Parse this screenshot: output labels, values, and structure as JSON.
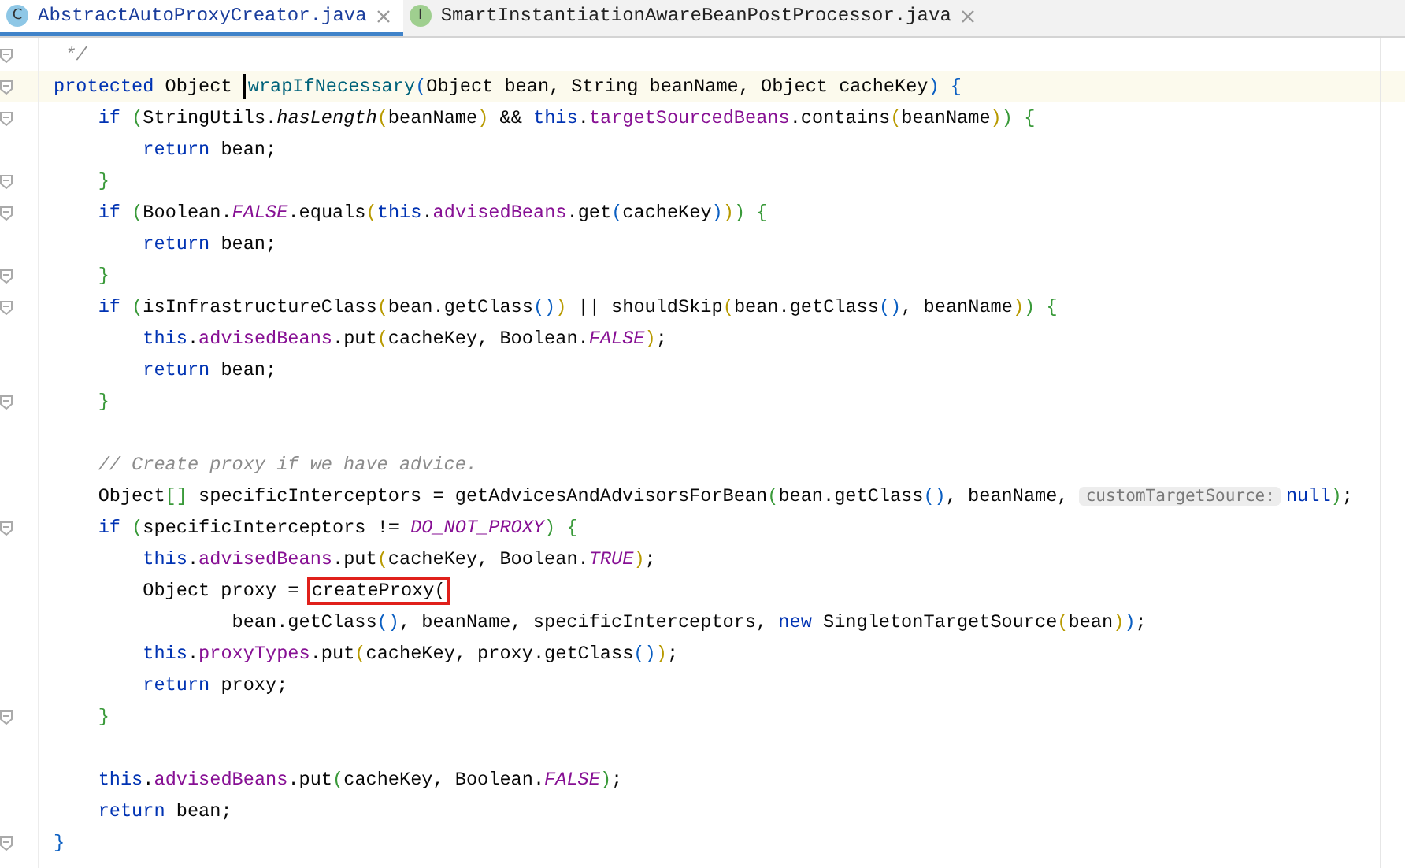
{
  "tabs": [
    {
      "badge": "C",
      "label": "AbstractAutoProxyCreator.java",
      "selected": true
    },
    {
      "badge": "I",
      "label": "SmartInstantiationAwareBeanPostProcessor.java",
      "selected": false
    }
  ],
  "code": [
    {
      "fold": true,
      "tokens": [
        {
          "kind": "comment",
          "text": "*/",
          "spaced": true
        }
      ]
    },
    {
      "fold": true,
      "current": true,
      "tokens": [
        {
          "kind": "keyword",
          "text": "protected"
        },
        {
          "kind": "plain",
          "text": " Object "
        },
        {
          "kind": "decl",
          "text": "wrapIfNecessary",
          "caret": true
        },
        {
          "kind": "bracket",
          "color": "#0b5fc2",
          "text": "("
        },
        {
          "kind": "plain",
          "text": "Object bean, String beanName, Object cacheKey"
        },
        {
          "kind": "bracket",
          "color": "#0b5fc2",
          "text": ")"
        },
        {
          "kind": "bracket",
          "color": "#0b5fc2",
          "text": "{",
          "spaced": true
        }
      ],
      "children": [
        {
          "fold": true,
          "tokens": [
            {
              "kind": "keyword",
              "text": "if"
            },
            {
              "kind": "bracket",
              "color": "#3a9a3a",
              "text": "(",
              "spaced": true
            },
            {
              "kind": "plain",
              "text": "StringUtils."
            },
            {
              "kind": "italic",
              "text": "hasLength"
            },
            {
              "kind": "bracket",
              "color": "#b89a00",
              "text": "("
            },
            {
              "kind": "plain",
              "text": "beanName"
            },
            {
              "kind": "bracket",
              "color": "#b89a00",
              "text": ")"
            },
            {
              "kind": "plain",
              "text": " && "
            },
            {
              "kind": "keyword",
              "text": "this"
            },
            {
              "kind": "plain",
              "text": "."
            },
            {
              "kind": "field",
              "text": "targetSourcedBeans"
            },
            {
              "kind": "plain",
              "text": ".contains"
            },
            {
              "kind": "bracket",
              "color": "#b89a00",
              "text": "("
            },
            {
              "kind": "plain",
              "text": "beanName"
            },
            {
              "kind": "bracket",
              "color": "#b89a00",
              "text": ")"
            },
            {
              "kind": "bracket",
              "color": "#3a9a3a",
              "text": ")"
            },
            {
              "kind": "bracket",
              "color": "#3a9a3a",
              "text": "{",
              "spaced": true
            }
          ],
          "children": [
            {
              "tokens": [
                {
                  "kind": "keyword",
                  "text": "return"
                },
                {
                  "kind": "plain",
                  "text": " bean;"
                }
              ]
            }
          ]
        },
        {
          "fold": true,
          "tokens": [
            {
              "kind": "bracket",
              "color": "#3a9a3a",
              "text": "}"
            }
          ]
        },
        {
          "fold": true,
          "tokens": [
            {
              "kind": "keyword",
              "text": "if"
            },
            {
              "kind": "bracket",
              "color": "#3a9a3a",
              "text": "(",
              "spaced": true
            },
            {
              "kind": "plain",
              "text": "Boolean."
            },
            {
              "kind": "constant",
              "text": "FALSE"
            },
            {
              "kind": "plain",
              "text": ".equals"
            },
            {
              "kind": "bracket",
              "color": "#b89a00",
              "text": "("
            },
            {
              "kind": "keyword",
              "text": "this"
            },
            {
              "kind": "plain",
              "text": "."
            },
            {
              "kind": "field",
              "text": "advisedBeans"
            },
            {
              "kind": "plain",
              "text": ".get"
            },
            {
              "kind": "bracket",
              "color": "#0b5fc2",
              "text": "("
            },
            {
              "kind": "plain",
              "text": "cacheKey"
            },
            {
              "kind": "bracket",
              "color": "#0b5fc2",
              "text": ")"
            },
            {
              "kind": "bracket",
              "color": "#b89a00",
              "text": ")"
            },
            {
              "kind": "bracket",
              "color": "#3a9a3a",
              "text": ")"
            },
            {
              "kind": "bracket",
              "color": "#3a9a3a",
              "text": "{",
              "spaced": true
            }
          ],
          "children": [
            {
              "tokens": [
                {
                  "kind": "keyword",
                  "text": "return"
                },
                {
                  "kind": "plain",
                  "text": " bean;"
                }
              ]
            }
          ]
        },
        {
          "fold": true,
          "tokens": [
            {
              "kind": "bracket",
              "color": "#3a9a3a",
              "text": "}"
            }
          ]
        },
        {
          "fold": true,
          "tokens": [
            {
              "kind": "keyword",
              "text": "if"
            },
            {
              "kind": "bracket",
              "color": "#3a9a3a",
              "text": "(",
              "spaced": true
            },
            {
              "kind": "plain",
              "text": "isInfrastructureClass"
            },
            {
              "kind": "bracket",
              "color": "#b89a00",
              "text": "("
            },
            {
              "kind": "plain",
              "text": "bean.getClass"
            },
            {
              "kind": "bracket",
              "color": "#0b5fc2",
              "text": "()"
            },
            {
              "kind": "bracket",
              "color": "#b89a00",
              "text": ")"
            },
            {
              "kind": "plain",
              "text": " || shouldSkip"
            },
            {
              "kind": "bracket",
              "color": "#b89a00",
              "text": "("
            },
            {
              "kind": "plain",
              "text": "bean.getClass"
            },
            {
              "kind": "bracket",
              "color": "#0b5fc2",
              "text": "()"
            },
            {
              "kind": "plain",
              "text": ", beanName"
            },
            {
              "kind": "bracket",
              "color": "#b89a00",
              "text": ")"
            },
            {
              "kind": "bracket",
              "color": "#3a9a3a",
              "text": ")"
            },
            {
              "kind": "bracket",
              "color": "#3a9a3a",
              "text": "{",
              "spaced": true
            }
          ],
          "children": [
            {
              "tokens": [
                {
                  "kind": "keyword",
                  "text": "this"
                },
                {
                  "kind": "plain",
                  "text": "."
                },
                {
                  "kind": "field",
                  "text": "advisedBeans"
                },
                {
                  "kind": "plain",
                  "text": ".put"
                },
                {
                  "kind": "bracket",
                  "color": "#b89a00",
                  "text": "("
                },
                {
                  "kind": "plain",
                  "text": "cacheKey, Boolean."
                },
                {
                  "kind": "constant",
                  "text": "FALSE"
                },
                {
                  "kind": "bracket",
                  "color": "#b89a00",
                  "text": ")"
                },
                {
                  "kind": "plain",
                  "text": ";"
                }
              ]
            },
            {
              "tokens": [
                {
                  "kind": "keyword",
                  "text": "return"
                },
                {
                  "kind": "plain",
                  "text": " bean;"
                }
              ]
            }
          ]
        },
        {
          "fold": true,
          "tokens": [
            {
              "kind": "bracket",
              "color": "#3a9a3a",
              "text": "}"
            }
          ]
        },
        {
          "kind": "blank"
        },
        {
          "tokens": [
            {
              "kind": "comment",
              "text": "// Create proxy if we have advice."
            }
          ]
        },
        {
          "tokens": [
            {
              "kind": "plain",
              "text": "Object"
            },
            {
              "kind": "bracket",
              "color": "#3a9a3a",
              "text": "[]"
            },
            {
              "kind": "plain",
              "text": " specificInterceptors = getAdvicesAndAdvisorsForBean"
            },
            {
              "kind": "bracket",
              "color": "#3a9a3a",
              "text": "("
            },
            {
              "kind": "plain",
              "text": "bean.getClass"
            },
            {
              "kind": "bracket",
              "color": "#0b5fc2",
              "text": "()"
            },
            {
              "kind": "plain",
              "text": ", beanName, "
            },
            {
              "kind": "hint",
              "text": "customTargetSource:"
            },
            {
              "kind": "keyword",
              "text": "null"
            },
            {
              "kind": "bracket",
              "color": "#3a9a3a",
              "text": ")"
            },
            {
              "kind": "plain",
              "text": ";"
            }
          ]
        },
        {
          "fold": true,
          "tokens": [
            {
              "kind": "keyword",
              "text": "if"
            },
            {
              "kind": "bracket",
              "color": "#3a9a3a",
              "text": "(",
              "spaced": true
            },
            {
              "kind": "plain",
              "text": "specificInterceptors != "
            },
            {
              "kind": "constant",
              "text": "DO_NOT_PROXY"
            },
            {
              "kind": "bracket",
              "color": "#3a9a3a",
              "text": ")"
            },
            {
              "kind": "bracket",
              "color": "#3a9a3a",
              "text": "{",
              "spaced": true
            }
          ],
          "children": [
            {
              "tokens": [
                {
                  "kind": "keyword",
                  "text": "this"
                },
                {
                  "kind": "plain",
                  "text": "."
                },
                {
                  "kind": "field",
                  "text": "advisedBeans"
                },
                {
                  "kind": "plain",
                  "text": ".put"
                },
                {
                  "kind": "bracket",
                  "color": "#b89a00",
                  "text": "("
                },
                {
                  "kind": "plain",
                  "text": "cacheKey, Boolean."
                },
                {
                  "kind": "constant",
                  "text": "TRUE"
                },
                {
                  "kind": "bracket",
                  "color": "#b89a00",
                  "text": ")"
                },
                {
                  "kind": "plain",
                  "text": ";"
                }
              ]
            },
            {
              "tokens": [
                {
                  "kind": "plain",
                  "text": "Object proxy = "
                },
                {
                  "kind": "plain",
                  "text": "createProxy(",
                  "boxed": true
                }
              ],
              "children": [
                {
                  "children": [
                    {
                      "tokens": [
                        {
                          "kind": "plain",
                          "text": "bean.getClass"
                        },
                        {
                          "kind": "bracket",
                          "color": "#0b5fc2",
                          "text": "()"
                        },
                        {
                          "kind": "plain",
                          "text": ", beanName, specificInterceptors, "
                        },
                        {
                          "kind": "keyword",
                          "text": "new"
                        },
                        {
                          "kind": "plain",
                          "text": " SingletonTargetSource"
                        },
                        {
                          "kind": "bracket",
                          "color": "#b89a00",
                          "text": "("
                        },
                        {
                          "kind": "plain",
                          "text": "bean"
                        },
                        {
                          "kind": "bracket",
                          "color": "#b89a00",
                          "text": ")"
                        },
                        {
                          "kind": "bracket",
                          "color": "#0b5fc2",
                          "text": ")"
                        },
                        {
                          "kind": "plain",
                          "text": ";"
                        }
                      ]
                    }
                  ]
                }
              ]
            },
            {
              "tokens": [
                {
                  "kind": "keyword",
                  "text": "this"
                },
                {
                  "kind": "plain",
                  "text": "."
                },
                {
                  "kind": "field",
                  "text": "proxyTypes"
                },
                {
                  "kind": "plain",
                  "text": ".put"
                },
                {
                  "kind": "bracket",
                  "color": "#b89a00",
                  "text": "("
                },
                {
                  "kind": "plain",
                  "text": "cacheKey, proxy.getClass"
                },
                {
                  "kind": "bracket",
                  "color": "#0b5fc2",
                  "text": "()"
                },
                {
                  "kind": "bracket",
                  "color": "#b89a00",
                  "text": ")"
                },
                {
                  "kind": "plain",
                  "text": ";"
                }
              ]
            },
            {
              "tokens": [
                {
                  "kind": "keyword",
                  "text": "return"
                },
                {
                  "kind": "plain",
                  "text": " proxy;"
                }
              ]
            }
          ]
        },
        {
          "fold": true,
          "tokens": [
            {
              "kind": "bracket",
              "color": "#3a9a3a",
              "text": "}"
            }
          ]
        },
        {
          "kind": "blank"
        },
        {
          "tokens": [
            {
              "kind": "keyword",
              "text": "this"
            },
            {
              "kind": "plain",
              "text": "."
            },
            {
              "kind": "field",
              "text": "advisedBeans"
            },
            {
              "kind": "plain",
              "text": ".put"
            },
            {
              "kind": "bracket",
              "color": "#3a9a3a",
              "text": "("
            },
            {
              "kind": "plain",
              "text": "cacheKey, Boolean."
            },
            {
              "kind": "constant",
              "text": "FALSE"
            },
            {
              "kind": "bracket",
              "color": "#3a9a3a",
              "text": ")"
            },
            {
              "kind": "plain",
              "text": ";"
            }
          ]
        },
        {
          "tokens": [
            {
              "kind": "keyword",
              "text": "return"
            },
            {
              "kind": "plain",
              "text": " bean;"
            }
          ]
        }
      ]
    },
    {
      "fold": true,
      "tokens": [
        {
          "kind": "bracket",
          "color": "#0b5fc2",
          "text": "}"
        }
      ]
    }
  ]
}
